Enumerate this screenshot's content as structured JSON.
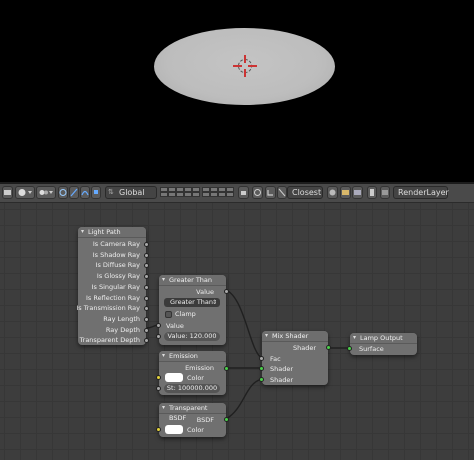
{
  "viewport": {
    "lamp_shape": "ellipse"
  },
  "header": {
    "transform_orientation": "Global",
    "snap_element": "Closest",
    "render_layer": "RenderLayer"
  },
  "nodes": {
    "light_path": {
      "title": "Light Path",
      "outputs": [
        "Is Camera Ray",
        "Is Shadow Ray",
        "Is Diffuse Ray",
        "Is Glossy Ray",
        "Is Singular Ray",
        "Is Reflection Ray",
        "Is Transmission Ray",
        "Ray Length",
        "Ray Depth",
        "Transparent Depth"
      ]
    },
    "greater_than": {
      "title": "Greater Than",
      "output": "Value",
      "operation": "Greater Than",
      "clamp_label": "Clamp",
      "input_label": "Value",
      "value_field": "Value: 120.000"
    },
    "emission": {
      "title": "Emission",
      "output": "Emission",
      "color_label": "Color",
      "strength_field": "St: 100000.000"
    },
    "transparent_bsdf": {
      "title": "Transparent BSDF",
      "output": "BSDF",
      "color_label": "Color"
    },
    "mix_shader": {
      "title": "Mix Shader",
      "output": "Shader",
      "inputs": [
        "Fac",
        "Shader",
        "Shader"
      ]
    },
    "lamp_output": {
      "title": "Lamp Output",
      "input": "Surface"
    }
  },
  "colors": {
    "shader_socket": "#4ad04a",
    "color_socket": "#e6d43a",
    "value_socket": "#a8a8a8",
    "editor_bg": "#3d3d3d",
    "node_body": "#707070"
  }
}
